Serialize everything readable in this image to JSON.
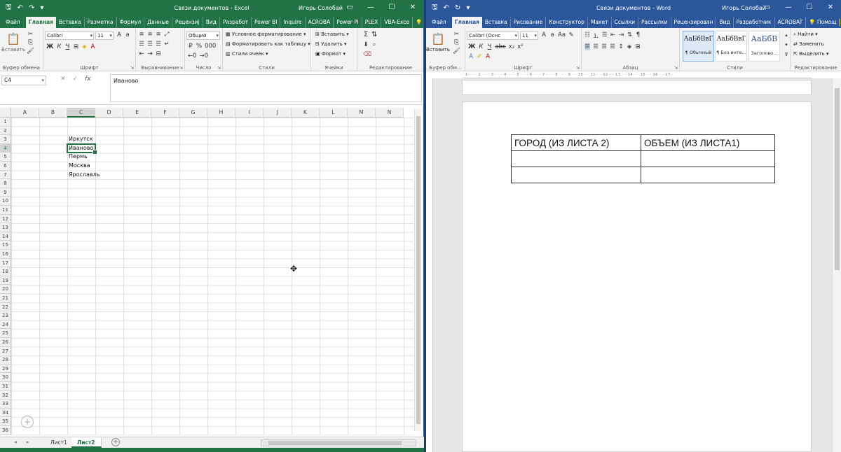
{
  "excel": {
    "title": "Связи документов  -  Excel",
    "user": "Игорь Солобай",
    "tabs": [
      "Файл",
      "Главная",
      "Вставка",
      "Разметка",
      "Формул",
      "Данные",
      "Рецензиј",
      "Вид",
      "Разработ",
      "Power BI",
      "Inquire",
      "ACROBA",
      "Power Pi",
      "PLEX",
      "VBA-Exce"
    ],
    "active_tab_index": 1,
    "tell_me": "Помощн",
    "ribbon": {
      "paste_label": "Вставить",
      "font_name": "Calibri",
      "font_size": "11",
      "number_format": "Общий",
      "cond_format": "Условное форматирование",
      "format_as_table": "Форматировать как таблицу",
      "cell_styles": "Стили ячеек",
      "insert": "Вставить",
      "delete": "Удалить",
      "format": "Формат",
      "groups": {
        "clipboard": "Буфер обмена",
        "font": "Шрифт",
        "alignment": "Выравнивание",
        "number": "Число",
        "styles": "Стили",
        "cells": "Ячейки",
        "editing": "Редактирование"
      }
    },
    "name_box": "C4",
    "formula_value": "Иваново",
    "columns": [
      "A",
      "B",
      "C",
      "D",
      "E",
      "F",
      "G",
      "H",
      "I",
      "J",
      "K",
      "L",
      "M",
      "N"
    ],
    "selected_column": "C",
    "rows": [
      "1",
      "2",
      "3",
      "4",
      "5",
      "6",
      "7",
      "8",
      "9",
      "10",
      "11",
      "12",
      "13",
      "14",
      "15",
      "16",
      "17",
      "18",
      "19",
      "20",
      "21",
      "22",
      "23",
      "24",
      "25",
      "26",
      "27",
      "28",
      "29",
      "30",
      "31",
      "32",
      "33",
      "34",
      "35",
      "36"
    ],
    "selected_row": "4",
    "cells": [
      {
        "ref": "C3",
        "value": "Иркутск"
      },
      {
        "ref": "C4",
        "value": "Иваново"
      },
      {
        "ref": "C5",
        "value": "Пермь"
      },
      {
        "ref": "C6",
        "value": "Москва"
      },
      {
        "ref": "C7",
        "value": "Ярославль"
      }
    ],
    "sheets": [
      "Лист1",
      "Лист2"
    ],
    "active_sheet": "Лист2"
  },
  "word": {
    "title": "Связи документов  -  Word",
    "user": "Игорь Солобай",
    "tabs": [
      "Файл",
      "Главная",
      "Вставка",
      "Рисование",
      "Конструктор",
      "Макет",
      "Ссылки",
      "Рассылки",
      "Рецензирован",
      "Вид",
      "Разработчик",
      "ACROBAT"
    ],
    "active_tab_index": 1,
    "tell_me": "Помощ",
    "ribbon": {
      "paste_label": "Вставить",
      "font_name": "Calibri (Оснс",
      "font_size": "11",
      "styles": [
        {
          "sample": "АаБбВвГ",
          "name": "¶ Обычный"
        },
        {
          "sample": "АаБбВвГ",
          "name": "¶ Без инте..."
        },
        {
          "sample": "АаБбВ",
          "name": "Заголово..."
        }
      ],
      "find": "Найти",
      "replace": "Заменить",
      "select": "Выделить",
      "groups": {
        "clipboard": "Буфер обм...",
        "font": "Шрифт",
        "paragraph": "Абзац",
        "styles": "Стили",
        "editing": "Редактирование"
      }
    },
    "table": {
      "headers": [
        "ГОРОД (ИЗ ЛИСТА 2)",
        "ОБЪЕМ (ИЗ ЛИСТА1)"
      ],
      "rows": [
        [
          "",
          ""
        ],
        [
          "",
          ""
        ]
      ]
    }
  }
}
